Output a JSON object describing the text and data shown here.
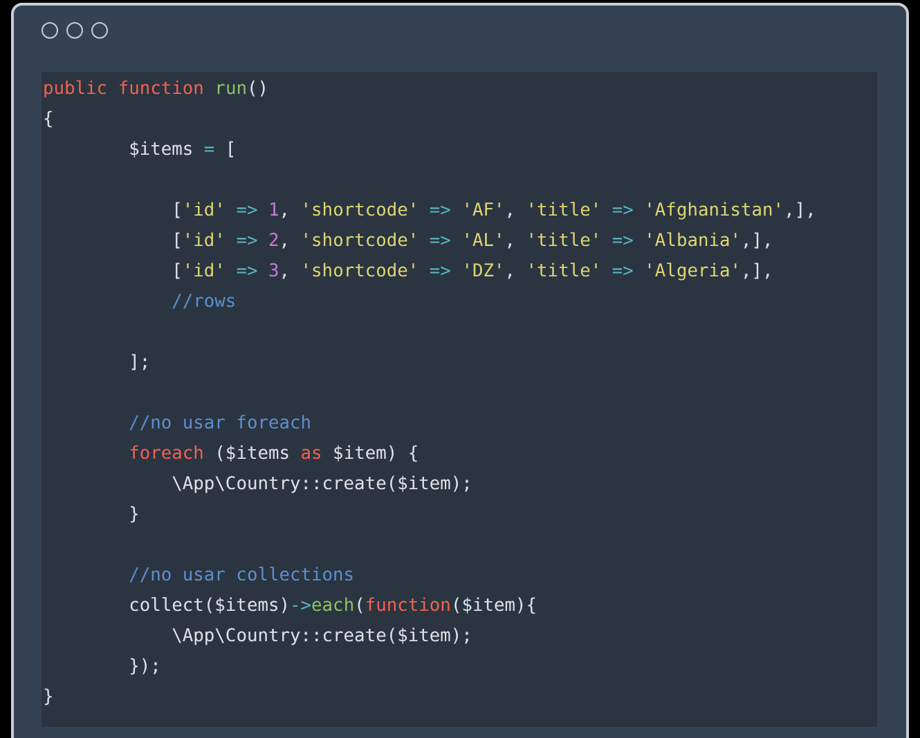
{
  "code": {
    "lines": [
      {
        "kind": "top",
        "tokens": [
          {
            "text": "public function",
            "kind": "kw"
          },
          {
            "text": " run",
            "kind": "fn"
          },
          {
            "text": "()",
            "kind": "plain"
          }
        ]
      },
      {
        "kind": "top",
        "tokens": [
          {
            "text": "{",
            "kind": "plain"
          }
        ]
      },
      {
        "kind": "inner",
        "tokens": [
          {
            "text": "$items ",
            "kind": "plain"
          },
          {
            "text": "=",
            "kind": "op"
          },
          {
            "text": " [",
            "kind": "plain"
          }
        ]
      },
      {
        "kind": "blank"
      },
      {
        "kind": "nested",
        "tokens": [
          {
            "text": "[",
            "kind": "plain"
          },
          {
            "text": "'id'",
            "kind": "str"
          },
          {
            "text": " => ",
            "kind": "op"
          },
          {
            "text": "1",
            "kind": "num"
          },
          {
            "text": ", ",
            "kind": "plain"
          },
          {
            "text": "'shortcode'",
            "kind": "str"
          },
          {
            "text": " => ",
            "kind": "op"
          },
          {
            "text": "'AF'",
            "kind": "str"
          },
          {
            "text": ", ",
            "kind": "plain"
          },
          {
            "text": "'title'",
            "kind": "str"
          },
          {
            "text": " => ",
            "kind": "op"
          },
          {
            "text": "'Afghanistan'",
            "kind": "str"
          },
          {
            "text": ",],",
            "kind": "plain"
          }
        ]
      },
      {
        "kind": "nested",
        "tokens": [
          {
            "text": "[",
            "kind": "plain"
          },
          {
            "text": "'id'",
            "kind": "str"
          },
          {
            "text": " => ",
            "kind": "op"
          },
          {
            "text": "2",
            "kind": "num"
          },
          {
            "text": ", ",
            "kind": "plain"
          },
          {
            "text": "'shortcode'",
            "kind": "str"
          },
          {
            "text": " => ",
            "kind": "op"
          },
          {
            "text": "'AL'",
            "kind": "str"
          },
          {
            "text": ", ",
            "kind": "plain"
          },
          {
            "text": "'title'",
            "kind": "str"
          },
          {
            "text": " => ",
            "kind": "op"
          },
          {
            "text": "'Albania'",
            "kind": "str"
          },
          {
            "text": ",],",
            "kind": "plain"
          }
        ]
      },
      {
        "kind": "nested",
        "tokens": [
          {
            "text": "[",
            "kind": "plain"
          },
          {
            "text": "'id'",
            "kind": "str"
          },
          {
            "text": " => ",
            "kind": "op"
          },
          {
            "text": "3",
            "kind": "num"
          },
          {
            "text": ", ",
            "kind": "plain"
          },
          {
            "text": "'shortcode'",
            "kind": "str"
          },
          {
            "text": " => ",
            "kind": "op"
          },
          {
            "text": "'DZ'",
            "kind": "str"
          },
          {
            "text": ", ",
            "kind": "plain"
          },
          {
            "text": "'title'",
            "kind": "str"
          },
          {
            "text": " => ",
            "kind": "op"
          },
          {
            "text": "'Algeria'",
            "kind": "str"
          },
          {
            "text": ",],",
            "kind": "plain"
          }
        ]
      },
      {
        "kind": "nested",
        "tokens": [
          {
            "text": "//rows",
            "kind": "comment"
          }
        ]
      },
      {
        "kind": "blank"
      },
      {
        "kind": "inner",
        "tokens": [
          {
            "text": "];",
            "kind": "plain"
          }
        ]
      },
      {
        "kind": "blank"
      },
      {
        "kind": "inner",
        "tokens": [
          {
            "text": "//no usar foreach",
            "kind": "comment"
          }
        ]
      },
      {
        "kind": "inner",
        "tokens": [
          {
            "text": "foreach",
            "kind": "kw"
          },
          {
            "text": " ($items ",
            "kind": "plain"
          },
          {
            "text": "as",
            "kind": "kw"
          },
          {
            "text": " $item) {",
            "kind": "plain"
          }
        ]
      },
      {
        "kind": "nested",
        "tokens": [
          {
            "text": "\\App\\Country::create($item);",
            "kind": "plain"
          }
        ]
      },
      {
        "kind": "inner",
        "tokens": [
          {
            "text": "}",
            "kind": "plain"
          }
        ]
      },
      {
        "kind": "blank"
      },
      {
        "kind": "inner",
        "tokens": [
          {
            "text": "//no usar collections",
            "kind": "comment"
          }
        ]
      },
      {
        "kind": "inner",
        "tokens": [
          {
            "text": "collect($items)",
            "kind": "plain"
          },
          {
            "text": "->",
            "kind": "op"
          },
          {
            "text": "each",
            "kind": "fn"
          },
          {
            "text": "(",
            "kind": "plain"
          },
          {
            "text": "function",
            "kind": "kw"
          },
          {
            "text": "($item){",
            "kind": "plain"
          }
        ]
      },
      {
        "kind": "nested",
        "tokens": [
          {
            "text": "\\App\\Country::create($item);",
            "kind": "plain"
          }
        ]
      },
      {
        "kind": "inner",
        "tokens": [
          {
            "text": "});",
            "kind": "plain"
          }
        ]
      },
      {
        "kind": "top",
        "tokens": [
          {
            "text": "}",
            "kind": "plain"
          }
        ]
      }
    ]
  }
}
